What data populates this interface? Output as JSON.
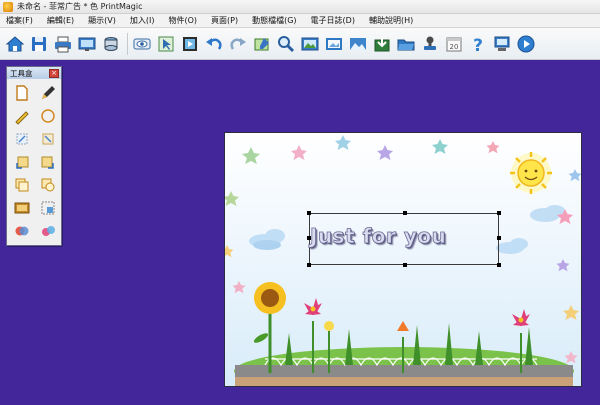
{
  "window": {
    "title": "未命名 - 菲常广告 * 色 PrintMagic"
  },
  "menubar": {
    "items": [
      {
        "label": "檔案(F)"
      },
      {
        "label": "編輯(E)"
      },
      {
        "label": "顯示(V)"
      },
      {
        "label": "加入(I)"
      },
      {
        "label": "物件(O)"
      },
      {
        "label": "頁面(P)"
      },
      {
        "label": "動態檔檔(G)"
      },
      {
        "label": "電子日誌(D)"
      },
      {
        "label": "輔助說明(H)"
      }
    ]
  },
  "palette": {
    "title": "工具盒",
    "close_label": "×"
  },
  "canvas": {
    "text": "Just for you",
    "text_color": "#d9dcef",
    "background_color": "#43279a"
  }
}
